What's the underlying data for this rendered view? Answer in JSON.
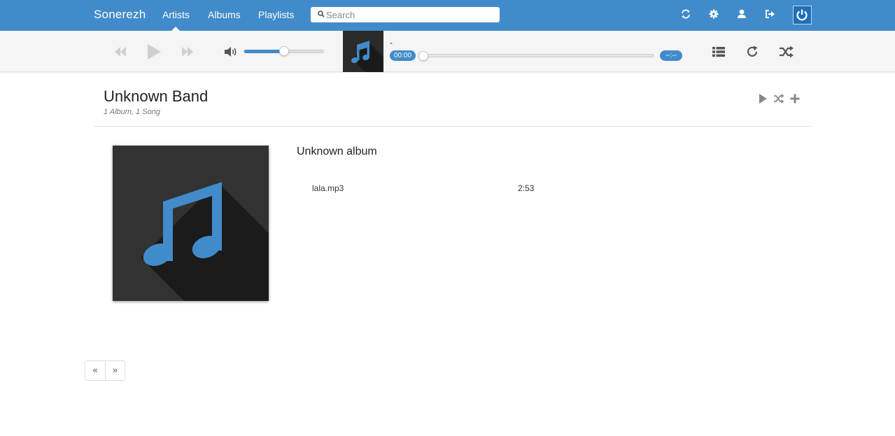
{
  "nav": {
    "brand": "Sonerezh",
    "links": [
      {
        "label": "Artists",
        "active": true
      },
      {
        "label": "Albums",
        "active": false
      },
      {
        "label": "Playlists",
        "active": false
      }
    ],
    "search_placeholder": "Search",
    "icons": [
      "sync-icon",
      "gear-icon",
      "user-icon",
      "logout-icon",
      "power-icon"
    ],
    "color": "#428bca"
  },
  "player": {
    "track_title": "-",
    "elapsed": "00:00",
    "remaining": "--:--",
    "volume": 0.5,
    "progress": 0
  },
  "artist": {
    "name": "Unknown Band",
    "summary": "1 Album, 1 Song",
    "actions": [
      "play-icon",
      "shuffle-icon",
      "plus-icon"
    ]
  },
  "album": {
    "title": "Unknown album",
    "songs": [
      {
        "name": "lala.mp3",
        "duration": "2:53"
      }
    ]
  },
  "pagination": {
    "prev": "«",
    "next": "»"
  }
}
